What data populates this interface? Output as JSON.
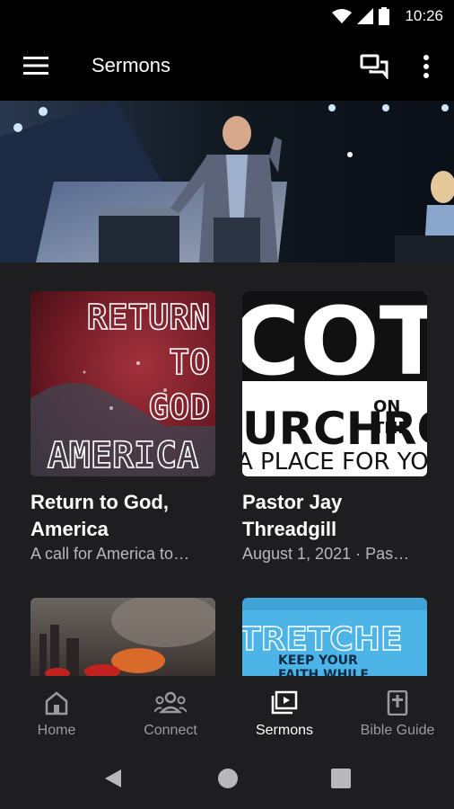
{
  "status": {
    "time": "10:26"
  },
  "appbar": {
    "title": "Sermons"
  },
  "cards": [
    {
      "title": "Return to God, America",
      "subtitle": "A call for America to…",
      "art": {
        "line1": "RETURN",
        "line2": "TO",
        "line3": "GOD",
        "line4": "AMERICA"
      }
    },
    {
      "title": "Pastor Jay Threadgill",
      "subtitle": "August 1, 2021 · Pas…",
      "art": {
        "big": "COTR",
        "mid": "URCH",
        "on": "ON",
        "the": "THE",
        "ro": "RO",
        "tag": "A PLACE FOR YOU"
      }
    }
  ],
  "cards_row2": [
    {
      "art_text": ""
    },
    {
      "art": {
        "big": "TRETCHE",
        "l1": "KEEP YOUR",
        "l2": "FAITH WHILE"
      }
    }
  ],
  "nav": [
    {
      "label": "Home",
      "icon": "home-icon"
    },
    {
      "label": "Connect",
      "icon": "people-icon"
    },
    {
      "label": "Sermons",
      "icon": "video-library-icon"
    },
    {
      "label": "Bible Guide",
      "icon": "bible-icon"
    }
  ],
  "colors": {
    "background": "#1e1e20",
    "bar": "#000000",
    "muted": "#9a9aa0"
  }
}
